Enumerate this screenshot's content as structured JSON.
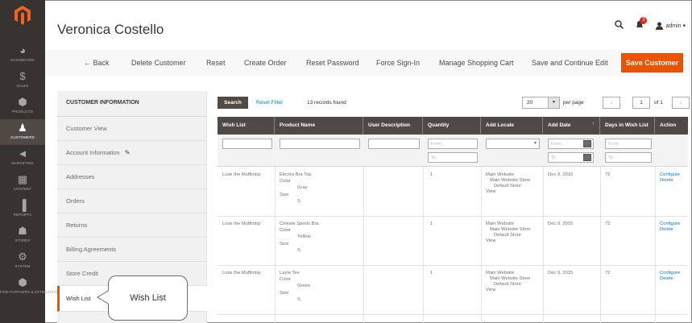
{
  "header": {
    "title": "Veronica Costello",
    "notifications_count": "3",
    "admin_label": "admin ▾"
  },
  "nav": [
    {
      "label": "DASHBOARD",
      "icon": "dashboard-icon",
      "glyph": "◕"
    },
    {
      "label": "SALES",
      "icon": "sales-icon",
      "glyph": "$"
    },
    {
      "label": "PRODUCTS",
      "icon": "products-icon",
      "glyph": "⬢"
    },
    {
      "label": "CUSTOMERS",
      "icon": "customers-icon",
      "glyph": "♟"
    },
    {
      "label": "MARKETING",
      "icon": "marketing-icon",
      "glyph": "◄"
    },
    {
      "label": "CONTENT",
      "icon": "content-icon",
      "glyph": "▦"
    },
    {
      "label": "REPORTS",
      "icon": "reports-icon",
      "glyph": "▐"
    },
    {
      "label": "STORES",
      "icon": "stores-icon",
      "glyph": "☗"
    },
    {
      "label": "SYSTEM",
      "icon": "system-icon",
      "glyph": "⚙"
    },
    {
      "label": "FIND PARTNERS & EXTENSIONS",
      "icon": "partners-icon",
      "glyph": "⬢"
    }
  ],
  "actions": {
    "back": "← Back",
    "delete": "Delete Customer",
    "reset": "Reset",
    "create_order": "Create Order",
    "reset_password": "Reset Password",
    "force_signin": "Force Sign-In",
    "manage_cart": "Manage Shopping Cart",
    "save_continue": "Save and Continue Edit",
    "save": "Save Customer"
  },
  "tabs": {
    "heading": "CUSTOMER INFORMATION",
    "items": [
      "Customer View",
      "Account Information",
      "Addresses",
      "Orders",
      "Returns",
      "Billing Agreements",
      "Store Credit",
      "Wish List"
    ],
    "active": "Wish List"
  },
  "callout": "Wish List",
  "grid": {
    "search_label": "Search",
    "reset_filter_label": "Reset Filter",
    "records_found": "13 records found",
    "per_page_value": "20",
    "per_page_label": "per page",
    "page_value": "1",
    "page_of": "of 1",
    "columns": [
      "Wish List",
      "Product Name",
      "User Description",
      "Quantity",
      "Add Locale",
      "Add Date",
      "Days in Wish List",
      "Action"
    ],
    "filter_placeholders": {
      "from": "From",
      "to": "To"
    },
    "rows": [
      {
        "wishlist": "Lose the Muffintop",
        "product": "Electra Bra Top",
        "option1_label": "Color",
        "option1_value": "Gray",
        "option2_label": "Size",
        "option2_value": "S",
        "description": "",
        "quantity": "1",
        "locale_1": "Main Website",
        "locale_2": "Main Website Store",
        "locale_3": "Default Store",
        "locale_4": "View",
        "date": "Dec 9, 2015",
        "days": "72",
        "action_1": "Configure",
        "action_2": "Delete"
      },
      {
        "wishlist": "Lose the Muffintop",
        "product": "Celeste Sports Bra",
        "option1_label": "Color",
        "option1_value": "Yellow",
        "option2_label": "Size",
        "option2_value": "S",
        "description": "",
        "quantity": "1",
        "locale_1": "Main Website",
        "locale_2": "Main Website Store",
        "locale_3": "Default Store",
        "locale_4": "View",
        "date": "Dec 9, 2015",
        "days": "72",
        "action_1": "Configure",
        "action_2": "Delete"
      },
      {
        "wishlist": "Lose the Muffintop",
        "product": "Layla Tee",
        "option1_label": "Color",
        "option1_value": "Green",
        "option2_label": "Size",
        "option2_value": "S",
        "description": "",
        "quantity": "1",
        "locale_1": "Main Website",
        "locale_2": "Main Website Store",
        "locale_3": "Default Store",
        "locale_4": "View",
        "date": "Dec 9, 2015",
        "days": "72",
        "action_1": "Configure",
        "action_2": "Delete"
      }
    ]
  },
  "colors": {
    "accent": "#eb5202",
    "nav_bg": "#373330",
    "grid_header": "#514943",
    "link": "#007bdb"
  }
}
